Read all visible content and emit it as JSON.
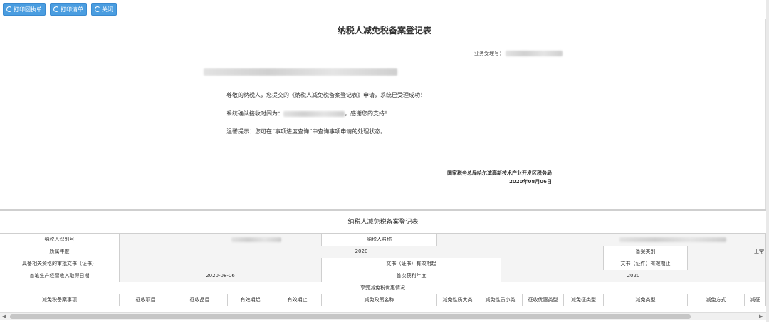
{
  "toolbar": {
    "print_receipt": "打印回执单",
    "print_list": "打印清单",
    "close": "关闭"
  },
  "receipt": {
    "title": "纳税人减免税备案登记表",
    "biz_no_label": "业务受理号：",
    "line1": "尊敬的纳税人，您提交的《纳税人减免税备案登记表》申请，系统已受理成功！",
    "line2_prefix": "系统确认接收时间为：",
    "line2_suffix": "，感谢您的支持！",
    "line3": "温馨提示：您可在“事项进度查询”中查询事项申请的处理状态。",
    "org": "国家税务总局哈尔滨高新技术产业开发区税务局",
    "date": "2020年08月06日"
  },
  "table": {
    "title": "纳税人减免税备案登记表",
    "row1": {
      "taxpayer_id_label": "纳税人识别号",
      "taxpayer_name_label": "纳税人名称"
    },
    "row2": {
      "year_label": "所属年度",
      "year_value": "2020",
      "type_label": "备案类别",
      "type_value": "正常"
    },
    "row3": {
      "doc_label": "具备相关资格的审批文书（证书）",
      "start_label": "文书（证书）有效期起",
      "end_label": "文书（证件）有效期止"
    },
    "row4": {
      "first_income_label": "首笔生产经营收入取得日期",
      "first_income_value": "2020-08-06",
      "first_profit_label": "首次获利年度",
      "first_profit_value": "2020"
    },
    "row5": {
      "enjoy_label": "享受减免税优惠情况"
    },
    "headers": [
      "减免税备案事项",
      "征收项目",
      "征收品目",
      "有效期起",
      "有效期止",
      "减免政策名称",
      "减免性质大类",
      "减免性质小类",
      "征收优惠类型",
      "减免征类型",
      "减免类型",
      "减免方式",
      "减征"
    ]
  }
}
